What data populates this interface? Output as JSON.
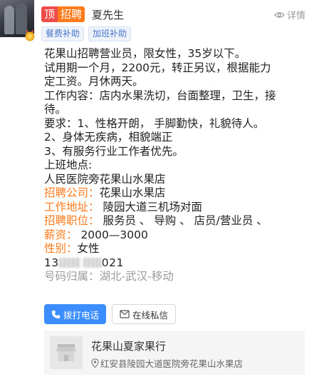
{
  "header": {
    "tag_top": "顶",
    "tag_hire": "招聘",
    "poster_name": "夏先生",
    "detail_label": "详情"
  },
  "badges": [
    "餐费补助",
    "加班补助"
  ],
  "body_lines": [
    "花果山招聘营业员，限女性，35岁以下。",
    "试用期一个月，2200元，转正另议，根据能力",
    "定工资。月休两天。",
    "工作内容：店内水果洗切，台面整理，卫生，接",
    "待。",
    "要求：1、性格开朗， 手脚勤快，礼貌待人。",
    "2、身体无疾病，相貌端正",
    "3、有服务行业工作者优先。",
    "上班地点:",
    "人民医院旁花果山水果店"
  ],
  "fields": [
    {
      "key": "招聘公司：",
      "value": "花果山水果店"
    },
    {
      "key": "工作地址：",
      "value": " 陵园大道三机场对面"
    },
    {
      "key": "招聘职位：",
      "value": " 服务员 、 导购 、 店员/营业员 、"
    },
    {
      "key": "薪资：",
      "value": "  2000—3000"
    },
    {
      "key": "性别：",
      "value": "女性"
    }
  ],
  "phone": {
    "prefix": "13",
    "masked_tail": "021"
  },
  "phone_location": {
    "label": "号码归属：",
    "value": "湖北-武汉-移动"
  },
  "actions": {
    "call_label": "拨打电话",
    "message_label": "在线私信"
  },
  "shop": {
    "name": "花果山夏家果行",
    "address": "红安县陵园大道医院旁花果山水果店"
  },
  "colors": {
    "tag_top": "#f04b4b",
    "tag_hire": "#ff7a1a",
    "field_key": "#ff7a1a",
    "primary_button": "#3c8dfd",
    "badge_text": "#4a78c8"
  }
}
